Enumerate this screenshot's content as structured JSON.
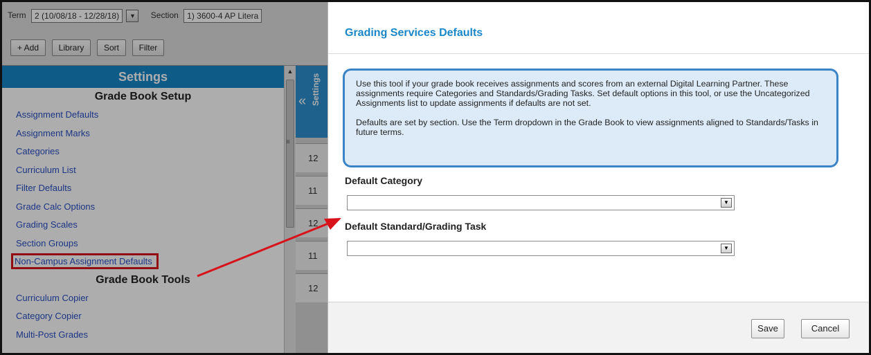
{
  "toolbar": {
    "term_label": "Term",
    "term_value": "2 (10/08/18 - 12/28/18)",
    "section_label": "Section",
    "section_value": "1) 3600-4 AP Litera",
    "buttons": [
      "+ Add",
      "Library",
      "Sort",
      "Filter"
    ]
  },
  "settings": {
    "title": "Settings",
    "setup_header": "Grade Book Setup",
    "setup_items": [
      "Assignment Defaults",
      "Assignment Marks",
      "Categories",
      "Curriculum List",
      "Filter Defaults",
      "Grade Calc Options",
      "Grading Scales",
      "Section Groups",
      "Non-Campus Assignment Defaults"
    ],
    "tools_header": "Grade Book Tools",
    "tools_items": [
      "Curriculum Copier",
      "Category Copier",
      "Multi-Post Grades"
    ],
    "side_tab_label": "Settings",
    "side_rows": [
      "12",
      "11",
      "12",
      "11",
      "12"
    ]
  },
  "modal": {
    "title": "Grading Services Defaults",
    "info_p1": "Use this tool if your grade book receives assignments and scores from an external Digital Learning Partner. These assignments require Categories and Standards/Grading Tasks. Set default options in this tool, or use the Uncategorized Assignments list to update assignments if defaults are not set.",
    "info_p2": "Defaults are set by section. Use the Term dropdown in the Grade Book to view assignments aligned to Standards/Tasks in future terms.",
    "default_category_label": "Default Category",
    "default_category_value": "",
    "default_standard_label": "Default Standard/Grading Task",
    "default_standard_value": "",
    "save_label": "Save",
    "cancel_label": "Cancel"
  },
  "colors": {
    "accent": "#1a87c9",
    "annotation": "#d8121b"
  }
}
